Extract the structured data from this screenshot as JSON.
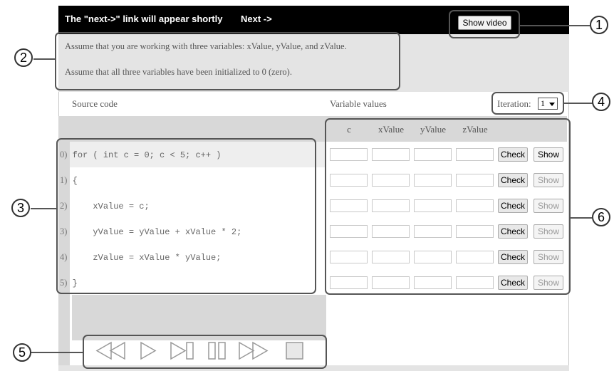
{
  "topbar": {
    "message": "The \"next->\" link will appear shortly",
    "next_link": "Next ->",
    "show_video": "Show video"
  },
  "instructions": {
    "line1": "Assume that you are working with three variables: xValue, yValue, and zValue.",
    "line2": "Assume that all three variables have been initialized to 0 (zero)."
  },
  "headers": {
    "source_code": "Source code",
    "variable_values": "Variable values",
    "iteration_label": "Iteration:",
    "iteration_value": "1"
  },
  "code": {
    "lines": [
      {
        "num": "0)",
        "text": "for ( int c = 0; c < 5; c++ )"
      },
      {
        "num": "1)",
        "text": "{"
      },
      {
        "num": "2)",
        "text": "    xValue = c;"
      },
      {
        "num": "3)",
        "text": "    yValue = yValue + xValue * 2;"
      },
      {
        "num": "4)",
        "text": "    zValue = xValue * yValue;"
      },
      {
        "num": "5)",
        "text": "}"
      }
    ]
  },
  "variables": {
    "columns": [
      "c",
      "xValue",
      "yValue",
      "zValue"
    ],
    "check_label": "Check",
    "show_label": "Show"
  },
  "callouts": [
    "1",
    "2",
    "3",
    "4",
    "5",
    "6"
  ],
  "colors": {
    "topbar": "#000000",
    "panel_gray": "#e4e4e4",
    "code_gray": "#d8d8d8",
    "callout_border": "#555555"
  }
}
